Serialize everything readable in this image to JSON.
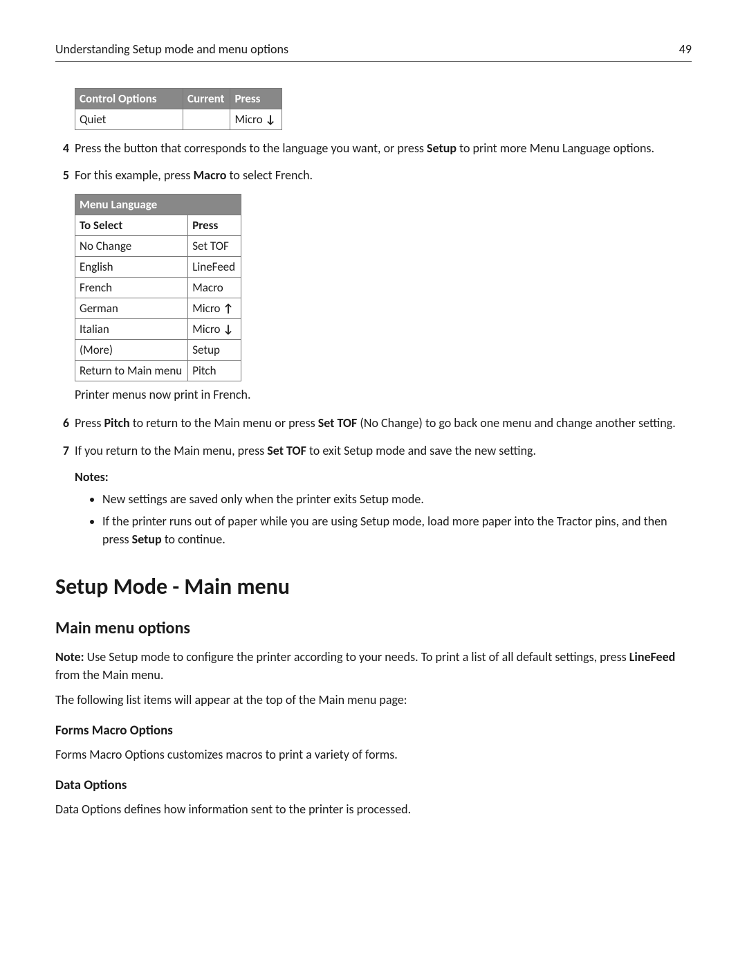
{
  "header": {
    "title": "Understanding Setup mode and menu options",
    "page_number": "49"
  },
  "table1": {
    "h1": "Control Options",
    "h2": "Current",
    "h3": "Press",
    "r1c1": "Quiet",
    "r1c2": "",
    "r1c3_prefix": "Micro ",
    "r1c3_arrow": "↓"
  },
  "steps": {
    "s4_num": "4",
    "s4_a": "Press the button that corresponds to the language you want, or press ",
    "s4_b_bold": "Setup",
    "s4_c": " to print more Menu Language options.",
    "s5_num": "5",
    "s5_a": "For this example, press ",
    "s5_b_bold": "Macro",
    "s5_c": " to select French.",
    "s6_num": "6",
    "s6_a": "Press ",
    "s6_b_bold": "Pitch",
    "s6_c": " to return to the Main menu or press ",
    "s6_d_bold": "Set TOF",
    "s6_e": " (No Change) to go back one menu and change another setting.",
    "s7_num": "7",
    "s7_a": "If you return to the Main menu, press ",
    "s7_b_bold": "Set TOF",
    "s7_c": " to exit Setup mode and save the new setting."
  },
  "table2": {
    "h1": "Menu Language",
    "sub1": "To Select",
    "sub2": "Press",
    "rows": [
      {
        "a": "No Change",
        "b": "Set TOF"
      },
      {
        "a": "English",
        "b": "LineFeed"
      },
      {
        "a": "French",
        "b": "Macro"
      },
      {
        "a": "German",
        "b_prefix": "Micro ",
        "b_arrow": "↑"
      },
      {
        "a": "Italian",
        "b_prefix": "Micro ",
        "b_arrow": "↓"
      },
      {
        "a": "(More)",
        "b": "Setup"
      },
      {
        "a": "Return to Main menu",
        "b": "Pitch"
      }
    ]
  },
  "caption": "Printer menus now print in French.",
  "notes_label": "Notes:",
  "notes": {
    "n1": "New settings are saved only when the printer exits Setup mode.",
    "n2_a": "If the printer runs out of paper while you are using Setup mode, load more paper into the Tractor pins, and then press ",
    "n2_b_bold": "Setup",
    "n2_c": " to continue."
  },
  "h1": "Setup Mode - Main menu",
  "h2": "Main menu options",
  "para1_a_bold": "Note:",
  "para1_b": " Use Setup mode to configure the printer according to your needs. To print a list of all default settings, press ",
  "para1_c_bold": "LineFeed",
  "para1_d": " from the Main menu.",
  "para2": "The following list items will appear at the top of the Main menu page:",
  "h3a": "Forms Macro Options",
  "para3": "Forms Macro Options customizes macros to print a variety of forms.",
  "h3b": "Data Options",
  "para4": "Data Options defines how information sent to the printer is processed."
}
